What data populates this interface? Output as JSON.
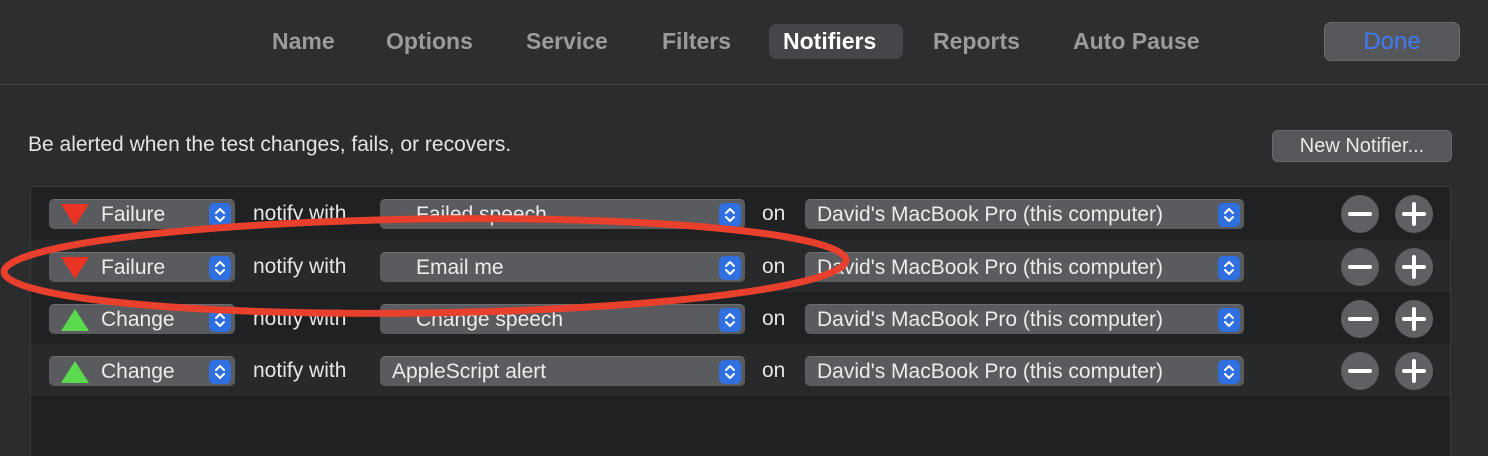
{
  "tabs": [
    {
      "label": "Name",
      "active": false
    },
    {
      "label": "Options",
      "active": false
    },
    {
      "label": "Service",
      "active": false
    },
    {
      "label": "Filters",
      "active": false
    },
    {
      "label": "Notifiers",
      "active": true
    },
    {
      "label": "Reports",
      "active": false
    },
    {
      "label": "Auto Pause",
      "active": false
    }
  ],
  "done_label": "Done",
  "description": "Be alerted when the test changes, fails, or recovers.",
  "new_notifier_label": "New Notifier...",
  "colors": {
    "failure_icon": "#ea3323",
    "change_icon": "#5bd94f",
    "stepper": "#2f6fe0",
    "annotation": "#e8402c",
    "done_text": "#3f7bf7"
  },
  "rows": [
    {
      "trigger": "Failure",
      "trigger_icon": "down-triangle-icon",
      "connector": "notify with",
      "action": "Failed speech",
      "on_label": "on",
      "target": "David's MacBook Pro (this computer)"
    },
    {
      "trigger": "Failure",
      "trigger_icon": "down-triangle-icon",
      "connector": "notify with",
      "action": "Email me",
      "on_label": "on",
      "target": "David's MacBook Pro (this computer)"
    },
    {
      "trigger": "Change",
      "trigger_icon": "up-triangle-icon",
      "connector": "notify with",
      "action": "Change speech",
      "on_label": "on",
      "target": "David's MacBook Pro (this computer)"
    },
    {
      "trigger": "Change",
      "trigger_icon": "up-triangle-icon",
      "connector": "notify with",
      "action": "AppleScript alert",
      "on_label": "on",
      "target": "David's MacBook Pro (this computer)"
    }
  ]
}
